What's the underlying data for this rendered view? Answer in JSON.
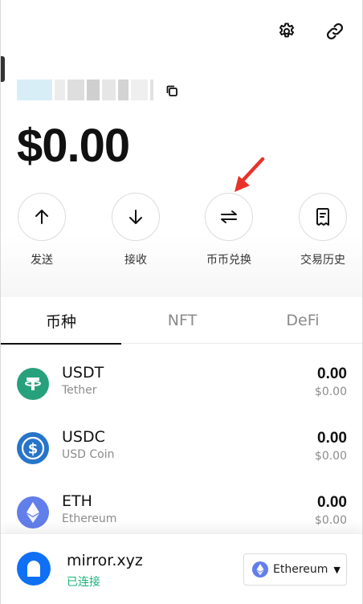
{
  "header": {
    "settings_icon": "gear-icon",
    "link_icon": "link-icon"
  },
  "wallet": {
    "balance": "$0.00",
    "copy_icon": "copy-icon"
  },
  "actions": [
    {
      "label": "发送",
      "icon": "arrow-up-icon"
    },
    {
      "label": "接收",
      "icon": "arrow-down-icon"
    },
    {
      "label": "币币兑换",
      "icon": "swap-icon"
    },
    {
      "label": "交易历史",
      "icon": "history-icon"
    }
  ],
  "tabs": [
    {
      "label": "币种",
      "active": true
    },
    {
      "label": "NFT",
      "active": false
    },
    {
      "label": "DeFi",
      "active": false
    }
  ],
  "tokens": [
    {
      "symbol": "USDT",
      "name": "Tether",
      "amount": "0.00",
      "fiat": "$0.00",
      "color": "#26a17b"
    },
    {
      "symbol": "USDC",
      "name": "USD Coin",
      "amount": "0.00",
      "fiat": "$0.00",
      "color": "#2775ca"
    },
    {
      "symbol": "ETH",
      "name": "Ethereum",
      "amount": "0.00",
      "fiat": "$0.00",
      "color": "#627eea"
    }
  ],
  "connection": {
    "site": "mirror.xyz",
    "status": "已连接",
    "network": "Ethereum"
  },
  "colors": {
    "annotation_arrow": "#e8322c",
    "connected_green": "#19b37a",
    "site_blue": "#0f6ff5"
  }
}
